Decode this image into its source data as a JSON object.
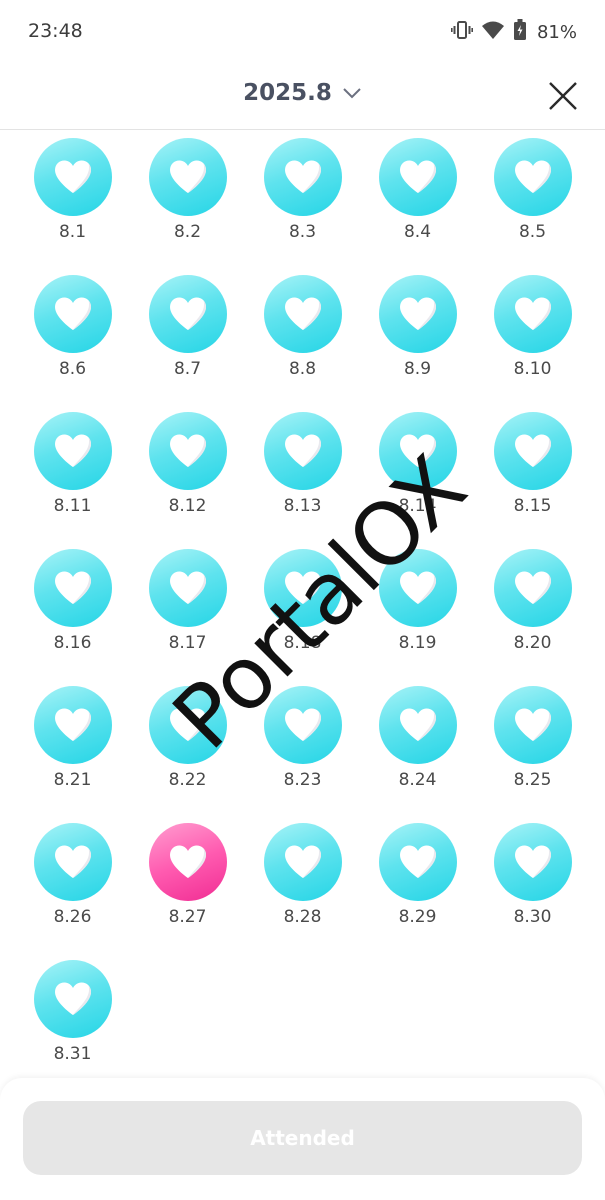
{
  "status_bar": {
    "time": "23:48",
    "battery": "81%",
    "icons": [
      "vibrate-icon",
      "wifi-icon",
      "battery-icon"
    ]
  },
  "header": {
    "title": "2025.8",
    "dropdown_icon": "chevron-down-icon",
    "close_icon": "close-icon"
  },
  "days": [
    {
      "label": "8.1",
      "state": "attended"
    },
    {
      "label": "8.2",
      "state": "attended"
    },
    {
      "label": "8.3",
      "state": "attended"
    },
    {
      "label": "8.4",
      "state": "attended"
    },
    {
      "label": "8.5",
      "state": "attended"
    },
    {
      "label": "8.6",
      "state": "attended"
    },
    {
      "label": "8.7",
      "state": "attended"
    },
    {
      "label": "8.8",
      "state": "attended"
    },
    {
      "label": "8.9",
      "state": "attended"
    },
    {
      "label": "8.10",
      "state": "attended"
    },
    {
      "label": "8.11",
      "state": "attended"
    },
    {
      "label": "8.12",
      "state": "attended"
    },
    {
      "label": "8.13",
      "state": "attended"
    },
    {
      "label": "8.14",
      "state": "attended"
    },
    {
      "label": "8.15",
      "state": "attended"
    },
    {
      "label": "8.16",
      "state": "attended"
    },
    {
      "label": "8.17",
      "state": "attended"
    },
    {
      "label": "8.18",
      "state": "attended"
    },
    {
      "label": "8.19",
      "state": "attended"
    },
    {
      "label": "8.20",
      "state": "attended"
    },
    {
      "label": "8.21",
      "state": "attended"
    },
    {
      "label": "8.22",
      "state": "attended"
    },
    {
      "label": "8.23",
      "state": "attended"
    },
    {
      "label": "8.24",
      "state": "attended"
    },
    {
      "label": "8.25",
      "state": "attended"
    },
    {
      "label": "8.26",
      "state": "attended"
    },
    {
      "label": "8.27",
      "state": "today"
    },
    {
      "label": "8.28",
      "state": "attended"
    },
    {
      "label": "8.29",
      "state": "attended"
    },
    {
      "label": "8.30",
      "state": "attended"
    },
    {
      "label": "8.31",
      "state": "attended"
    }
  ],
  "colors": {
    "attended": "#3ddbe9",
    "today": "#f53c9f",
    "heart": "#ffffff"
  },
  "watermark": "PortalOX",
  "footer": {
    "button_label": "Attended"
  }
}
